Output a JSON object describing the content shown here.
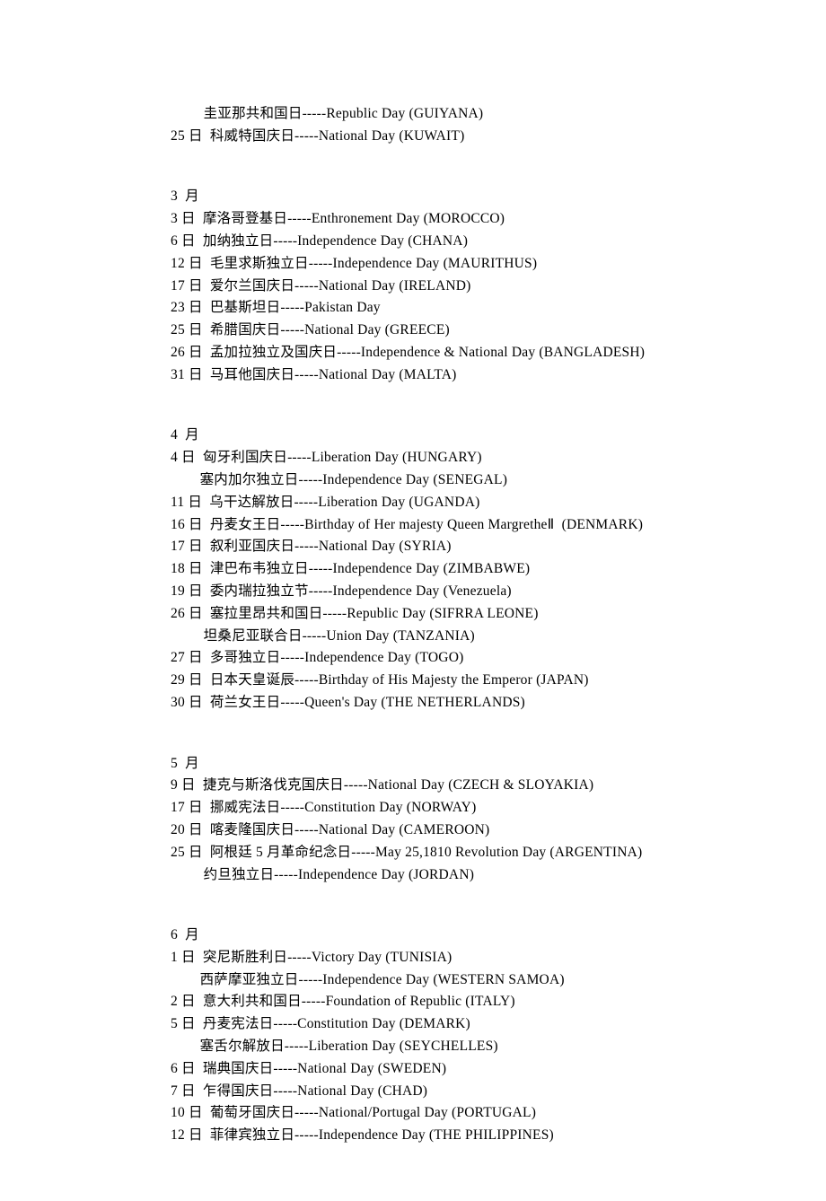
{
  "lines": [
    {
      "text": "         圭亚那共和国日-----Republic Day (GUIYANA)",
      "cls": "line first"
    },
    {
      "text": "25 日  科威特国庆日-----National Day (KUWAIT)",
      "cls": "line"
    },
    {
      "text": " ",
      "cls": "line"
    },
    {
      "text": "3  月",
      "cls": "line month-header"
    },
    {
      "text": "3 日  摩洛哥登基日-----Enthronement Day (MOROCCO)",
      "cls": "line"
    },
    {
      "text": "6 日  加纳独立日-----Independence Day (CHANA)",
      "cls": "line"
    },
    {
      "text": "12 日  毛里求斯独立日-----Independence Day (MAURITHUS)",
      "cls": "line"
    },
    {
      "text": "17 日  爱尔兰国庆日-----National Day (IRELAND)",
      "cls": "line"
    },
    {
      "text": "23 日  巴基斯坦日-----Pakistan Day",
      "cls": "line"
    },
    {
      "text": "25 日  希腊国庆日-----National Day (GREECE)",
      "cls": "line"
    },
    {
      "text": "26 日  孟加拉独立及国庆日-----Independence & National Day (BANGLADESH)",
      "cls": "line"
    },
    {
      "text": "31 日  马耳他国庆日-----National Day (MALTA)",
      "cls": "line"
    },
    {
      "text": " ",
      "cls": "line"
    },
    {
      "text": "4  月",
      "cls": "line month-header"
    },
    {
      "text": "4 日  匈牙利国庆日-----Liberation Day (HUNGARY)",
      "cls": "line"
    },
    {
      "text": "        塞内加尔独立日-----Independence Day (SENEGAL)",
      "cls": "line"
    },
    {
      "text": "11 日  乌干达解放日-----Liberation Day (UGANDA)",
      "cls": "line"
    },
    {
      "text": "16 日  丹麦女王日-----Birthday of Her majesty Queen MargretheⅡ  (DENMARK)",
      "cls": "line"
    },
    {
      "text": "17 日  叙利亚国庆日-----National Day (SYRIA)",
      "cls": "line"
    },
    {
      "text": "18 日  津巴布韦独立日-----Independence Day (ZIMBABWE)",
      "cls": "line"
    },
    {
      "text": "19 日  委内瑞拉独立节-----Independence Day (Venezuela)",
      "cls": "line"
    },
    {
      "text": "26 日  塞拉里昂共和国日-----Republic Day (SIFRRA LEONE)",
      "cls": "line"
    },
    {
      "text": "         坦桑尼亚联合日-----Union Day (TANZANIA)",
      "cls": "line"
    },
    {
      "text": "27 日  多哥独立日-----Independence Day (TOGO)",
      "cls": "line"
    },
    {
      "text": "29 日  日本天皇诞辰-----Birthday of His Majesty the Emperor (JAPAN)",
      "cls": "line"
    },
    {
      "text": "30 日  荷兰女王日-----Queen's Day (THE NETHERLANDS)",
      "cls": "line"
    },
    {
      "text": " ",
      "cls": "line"
    },
    {
      "text": "5  月",
      "cls": "line month-header"
    },
    {
      "text": "9 日  捷克与斯洛伐克国庆日-----National Day (CZECH & SLOYAKIA)",
      "cls": "line"
    },
    {
      "text": "17 日  挪威宪法日-----Constitution Day (NORWAY)",
      "cls": "line"
    },
    {
      "text": "20 日  喀麦隆国庆日-----National Day (CAMEROON)",
      "cls": "line"
    },
    {
      "text": "25 日  阿根廷 5 月革命纪念日-----May 25,1810 Revolution Day (ARGENTINA)",
      "cls": "line"
    },
    {
      "text": "         约旦独立日-----Independence Day (JORDAN)",
      "cls": "line"
    },
    {
      "text": " ",
      "cls": "line"
    },
    {
      "text": "6  月",
      "cls": "line month-header"
    },
    {
      "text": "1 日  突尼斯胜利日-----Victory Day (TUNISIA)",
      "cls": "line"
    },
    {
      "text": "        西萨摩亚独立日-----Independence Day (WESTERN SAMOA)",
      "cls": "line"
    },
    {
      "text": "2 日  意大利共和国日-----Foundation of Republic (ITALY)",
      "cls": "line"
    },
    {
      "text": "5 日  丹麦宪法日-----Constitution Day (DEMARK)",
      "cls": "line"
    },
    {
      "text": "        塞舌尔解放日-----Liberation Day (SEYCHELLES)",
      "cls": "line"
    },
    {
      "text": "6 日  瑞典国庆日-----National Day (SWEDEN)",
      "cls": "line"
    },
    {
      "text": "7 日  乍得国庆日-----National Day (CHAD)",
      "cls": "line"
    },
    {
      "text": "10 日  葡萄牙国庆日-----National/Portugal Day (PORTUGAL)",
      "cls": "line"
    },
    {
      "text": "12 日  菲律宾独立日-----Independence Day (THE PHILIPPINES)",
      "cls": "line"
    }
  ]
}
